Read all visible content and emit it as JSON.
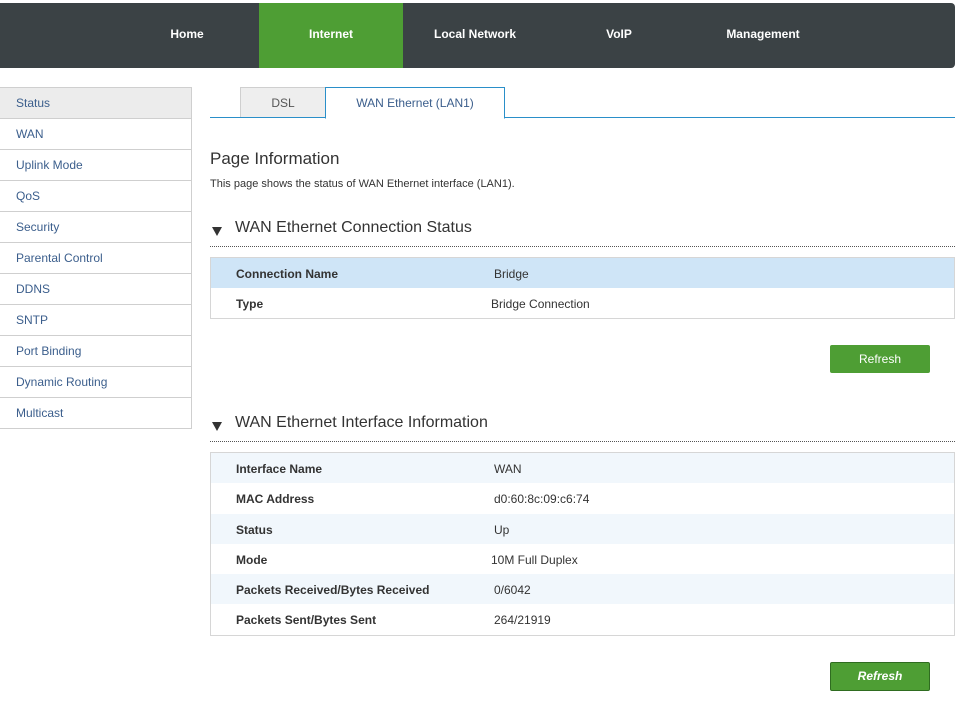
{
  "topnav": {
    "items": [
      {
        "label": "Home"
      },
      {
        "label": "Internet"
      },
      {
        "label": "Local Network"
      },
      {
        "label": "VoIP"
      },
      {
        "label": "Management"
      }
    ],
    "active": "Internet",
    "active_color": "#4e9e34",
    "background": "#3b4245"
  },
  "sidebar": {
    "items": [
      {
        "label": "Status"
      },
      {
        "label": "WAN"
      },
      {
        "label": "Uplink Mode"
      },
      {
        "label": "QoS"
      },
      {
        "label": "Security"
      },
      {
        "label": "Parental Control"
      },
      {
        "label": "DDNS"
      },
      {
        "label": "SNTP"
      },
      {
        "label": "Port Binding"
      },
      {
        "label": "Dynamic Routing"
      },
      {
        "label": "Multicast"
      }
    ],
    "active": "Status"
  },
  "tabs": [
    {
      "label": "DSL"
    },
    {
      "label": "WAN Ethernet (LAN1)"
    }
  ],
  "page": {
    "title": "Page Information",
    "description": "This page shows the status of WAN Ethernet interface (LAN1)."
  },
  "connection_status": {
    "title": "WAN Ethernet Connection Status",
    "rows": [
      {
        "key": "Connection Name",
        "value": "Bridge"
      },
      {
        "key": "Type",
        "value": "Bridge Connection"
      }
    ],
    "refresh_label": "Refresh"
  },
  "interface_info": {
    "title": "WAN Ethernet Interface Information",
    "rows": [
      {
        "key": "Interface Name",
        "value": "WAN"
      },
      {
        "key": "MAC Address",
        "value": "d0:60:8c:09:c6:74"
      },
      {
        "key": "Status",
        "value": "Up"
      },
      {
        "key": "Mode",
        "value": "10M Full Duplex"
      },
      {
        "key": "Packets Received/Bytes Received",
        "value": "0/6042"
      },
      {
        "key": "Packets Sent/Bytes Sent",
        "value": "264/21919"
      }
    ],
    "refresh_label": "Refresh"
  }
}
